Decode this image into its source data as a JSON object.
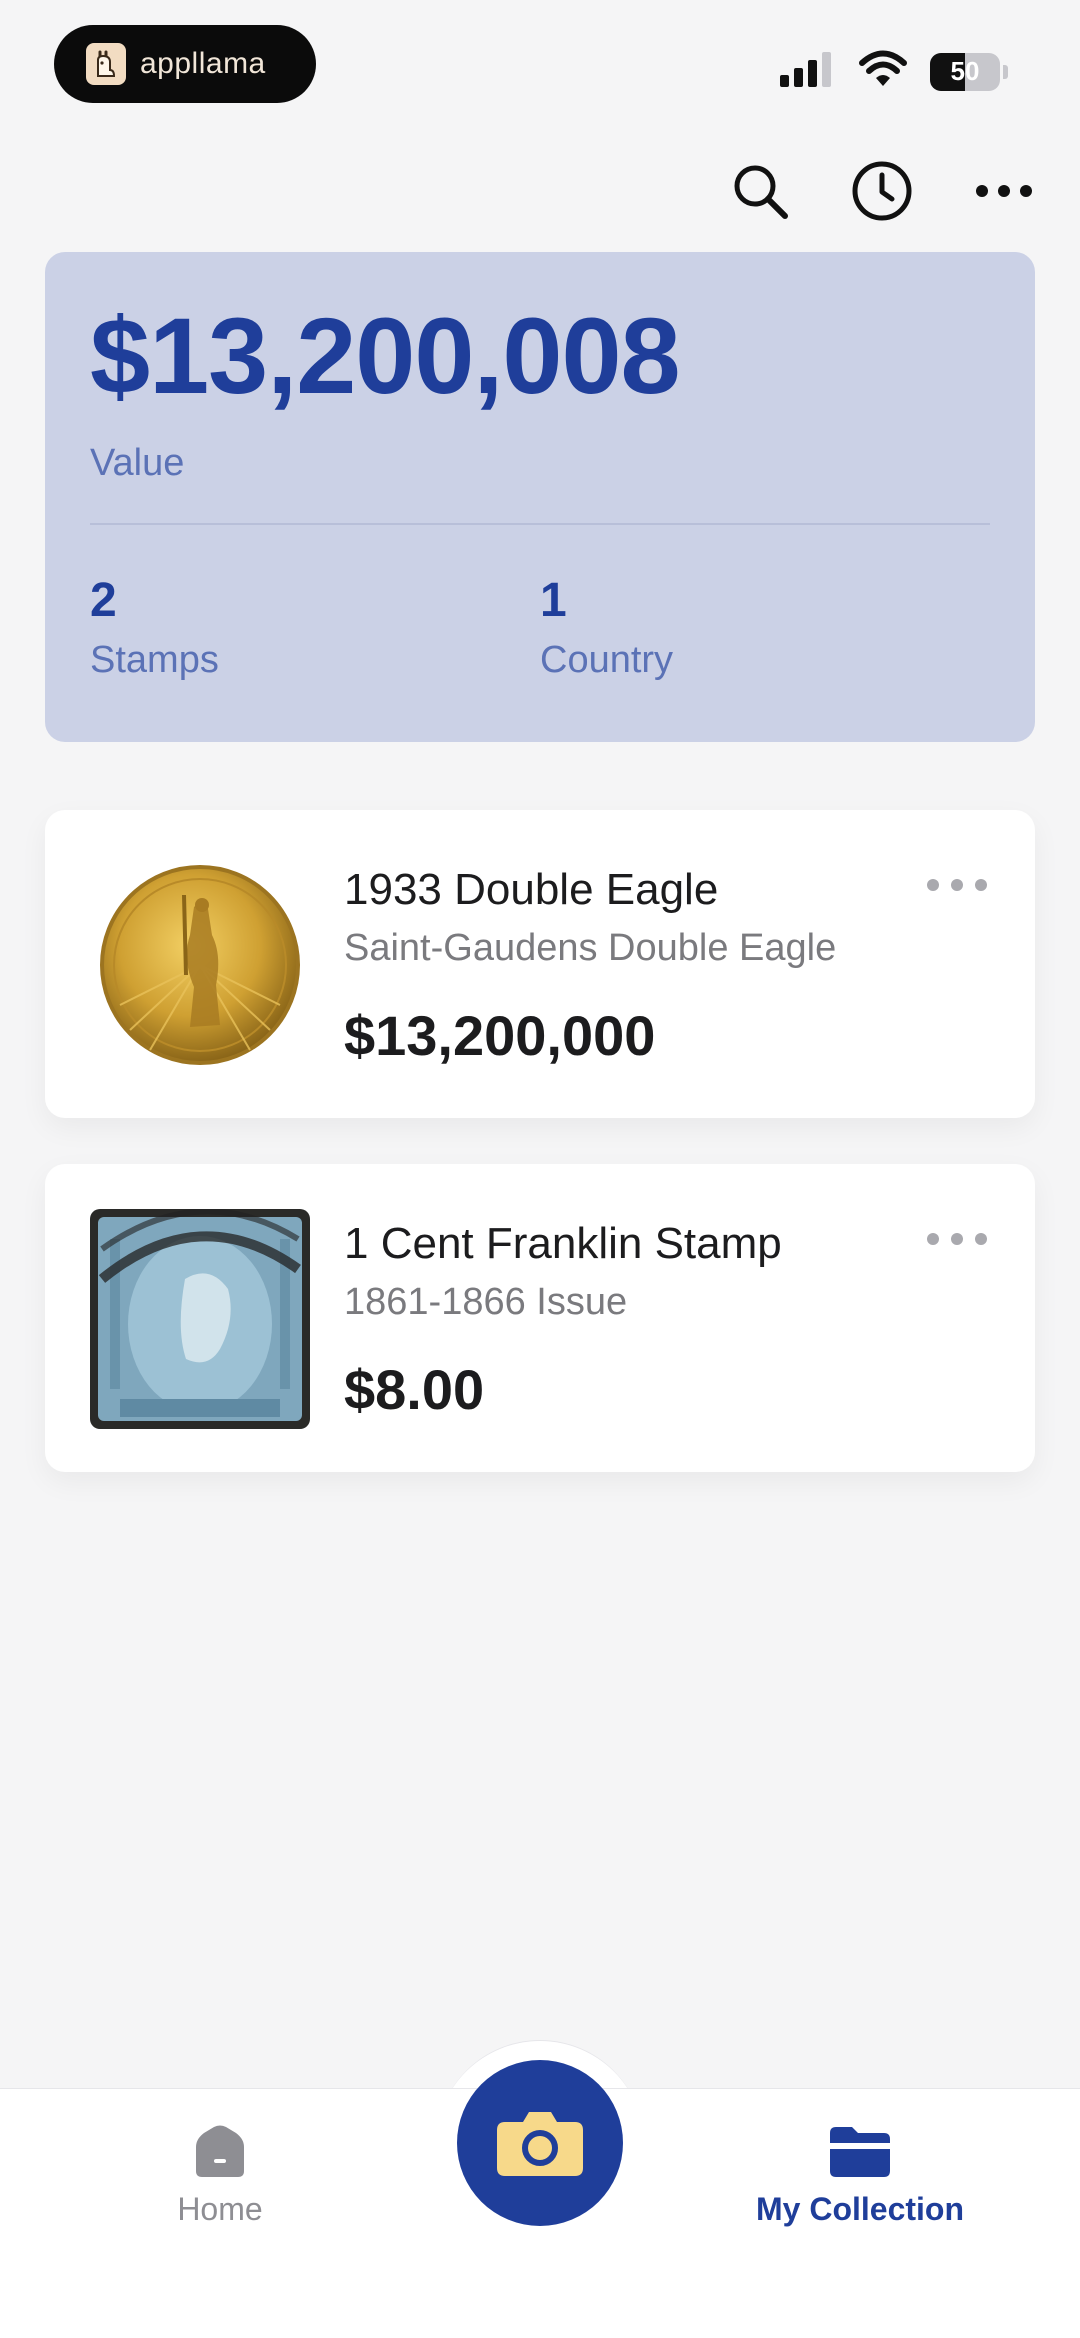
{
  "status_bar": {
    "app_name": "appllama",
    "battery": "50",
    "battery_level": 0.5,
    "icons": [
      "signal-icon",
      "wifi-icon",
      "battery-icon"
    ]
  },
  "toolbar": {
    "icons": [
      "search-icon",
      "history-clock-icon",
      "more-icon"
    ]
  },
  "summary": {
    "total_value": "$13,200,008",
    "value_label": "Value",
    "stamps_count": "2",
    "stamps_label": "Stamps",
    "country_count": "1",
    "country_label": "Country"
  },
  "items": [
    {
      "title": "1933 Double Eagle",
      "subtitle": "Saint-Gaudens Double Eagle",
      "price": "$13,200,000",
      "thumb": "gold-coin-image"
    },
    {
      "title": "1 Cent Franklin Stamp",
      "subtitle": "1861-1866 Issue",
      "price": "$8.00",
      "thumb": "blue-stamp-image"
    }
  ],
  "tabbar": {
    "home_label": "Home",
    "collection_label": "My Collection",
    "active_tab": "My Collection"
  },
  "colors": {
    "accent": "#1f3e9a",
    "summary_bg": "#cbd1e6",
    "muted_blue": "#5b72b6",
    "background": "#f5f5f6",
    "camera_lens": "#f7d98a"
  }
}
